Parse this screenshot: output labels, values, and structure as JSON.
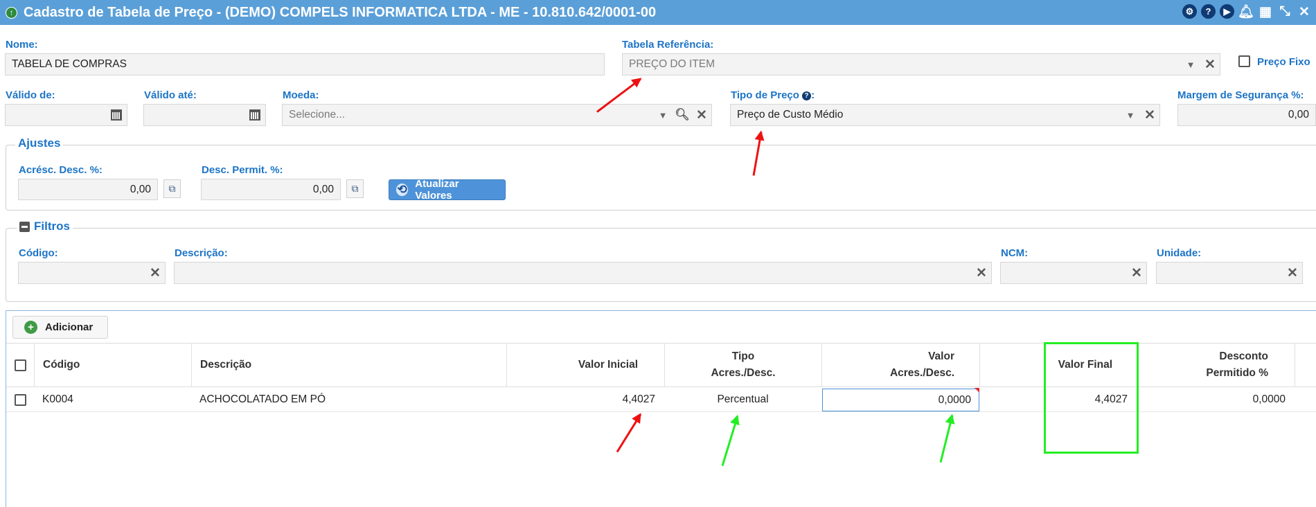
{
  "window": {
    "title": "Cadastro de Tabela de Preço - (DEMO) COMPELS INFORMATICA LTDA - ME - 10.810.642/0001-00",
    "app_icon": "arrow-up-circle-icon",
    "toolbar_icons": [
      "settings-icon",
      "help-icon",
      "play-icon",
      "bell-icon",
      "calendar-icon",
      "expand-icon",
      "close-icon"
    ]
  },
  "form": {
    "nome_label": "Nome:",
    "nome_value": "TABELA DE COMPRAS",
    "tabela_ref_label": "Tabela Referência:",
    "tabela_ref_value": "PREÇO DO ITEM",
    "preco_fixo_label": "Preço Fixo",
    "valido_de_label": "Válido de:",
    "valido_ate_label": "Válido até:",
    "moeda_label": "Moeda:",
    "moeda_placeholder": "Selecione...",
    "tipo_preco_label": "Tipo de Preço",
    "tipo_preco_suffix": ":",
    "tipo_preco_value": "Preço de Custo Médio",
    "margem_label": "Margem de Segurança %:",
    "margem_value": "0,00"
  },
  "ajustes": {
    "legend": "Ajustes",
    "acresc_label": "Acrésc. Desc. %:",
    "acresc_value": "0,00",
    "desc_permit_label": "Desc. Permit. %:",
    "desc_permit_value": "0,00",
    "atualizar_label": "Atualizar Valores"
  },
  "filtros": {
    "legend": "Filtros",
    "codigo_label": "Código:",
    "descricao_label": "Descrição:",
    "ncm_label": "NCM:",
    "unidade_label": "Unidade:"
  },
  "grid": {
    "add_label": "Adicionar",
    "columns": {
      "codigo": "Código",
      "descricao": "Descrição",
      "valor_inicial": "Valor Inicial",
      "tipo_line1": "Tipo",
      "tipo_line2": "Acres./Desc.",
      "valor_line1": "Valor",
      "valor_line2": "Acres./Desc.",
      "valor_final": "Valor Final",
      "desconto_line1": "Desconto",
      "desconto_line2": "Permitido %"
    },
    "rows": [
      {
        "codigo": "K0004",
        "descricao": "ACHOCOLATADO EM PÓ",
        "valor_inicial": "4,4027",
        "tipo": "Percentual",
        "valor_acres": "0,0000",
        "valor_final": "4,4027",
        "desconto": "0,0000"
      }
    ]
  },
  "annotation_colors": {
    "red": "#ee1111",
    "green": "#22ee22"
  }
}
